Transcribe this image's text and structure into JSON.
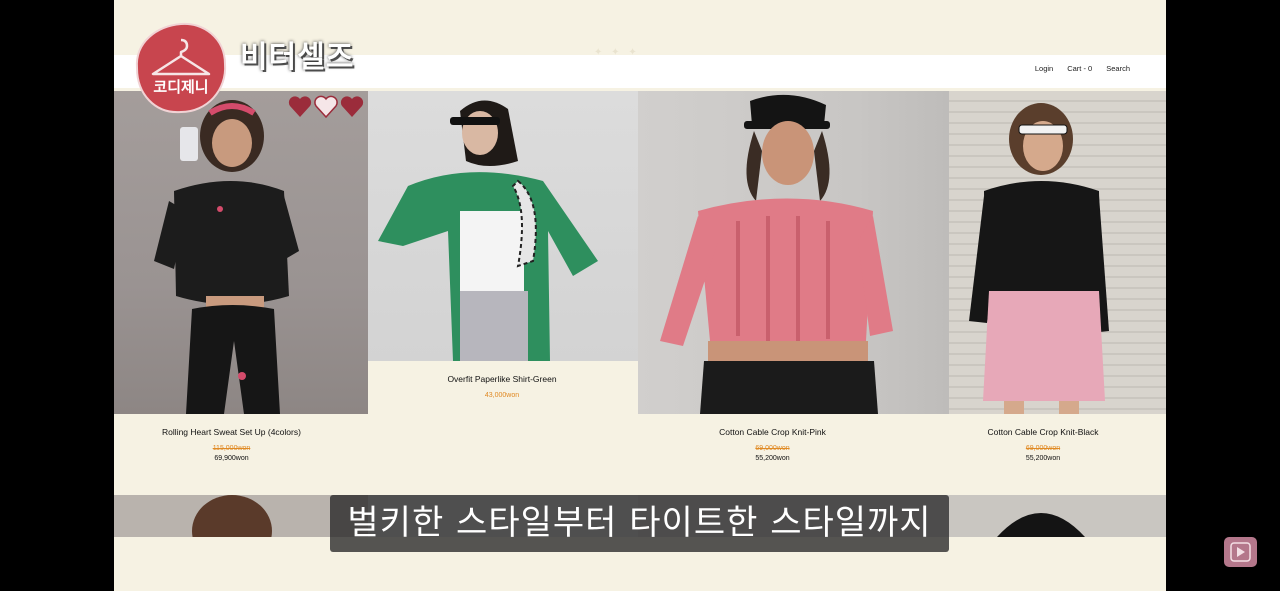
{
  "channel": {
    "logo_text": "코디제니",
    "overlay_title": "비터셀즈"
  },
  "header": {
    "nav": {
      "login": "Login",
      "cart": "Cart - 0",
      "search": "Search"
    }
  },
  "products": [
    {
      "name": "Rolling Heart Sweat Set Up (4colors)",
      "old_price": "115,000won",
      "price": "69,900won"
    },
    {
      "name": "Overfit Paperlike Shirt-Green",
      "price": "43,000won"
    },
    {
      "name": "Cotton Cable Crop Knit-Pink",
      "old_price": "69,000won",
      "price": "55,200won"
    },
    {
      "name": "Cotton Cable Crop Knit-Black",
      "old_price": "69,000won",
      "price": "55,200won"
    }
  ],
  "subtitle": "벌키한 스타일부터 타이트한 스타일까지",
  "colors": {
    "page_bg": "#f6f2e3",
    "price_accent": "#e08a24",
    "logo_red": "#c8454e",
    "player_button": "#b4778b"
  },
  "icons": [
    "hanger-icon",
    "heart-badge-icon",
    "play-icon"
  ]
}
